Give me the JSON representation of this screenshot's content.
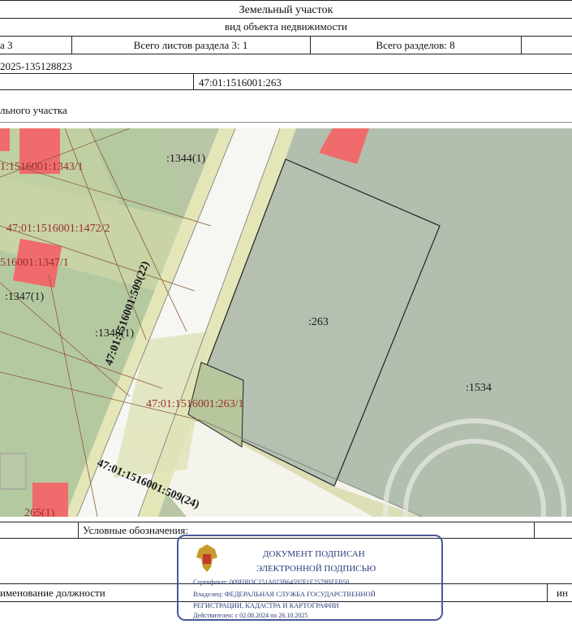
{
  "header": {
    "title": "Земельный участок",
    "subtitle": "вид объекта недвижимости"
  },
  "info_row": {
    "section": "а 3",
    "sheets": "Всего листов раздела 3: 1",
    "sections_total": "Всего разделов: 8"
  },
  "record_number": "2025-135128823",
  "cadastral_number": "47:01:1516001:263",
  "plan_title": "льного участка",
  "map": {
    "labels_red": [
      "1:1516001:1343/1",
      "47:01:1516001:1472/2",
      "516001:1347/1",
      "47:01:1516001:263/1",
      "265(1)"
    ],
    "labels_black": [
      ":1344(1)",
      ":1347(1)",
      ":1348(1)",
      ":263",
      ":1534"
    ],
    "road_labels": [
      "47:01:1516001:509(22)",
      "47:01:1516001:509(24)"
    ]
  },
  "legend": "Условные обозначения:",
  "footer": {
    "position_label": "именование должности",
    "right_label": "ин"
  },
  "signature": {
    "line1": "ДОКУМЕНТ ПОДПИСАН",
    "line2": "ЭЛЕКТРОННОЙ ПОДПИСЬЮ",
    "cert": "Сертификат: 009F0B3C151A023B64597F1E2579BEFB50",
    "owner1": "Владелец: ФЕДЕРАЛЬНАЯ СЛУЖБА ГОСУДАРСТВЕННОЙ",
    "owner2": "РЕГИСТРАЦИИ, КАДАСТРА И КАРТОГРАФИИ",
    "valid": "Действителен: с 02.08.2024 по 26.10.2025"
  },
  "colors": {
    "map_green": "#b7c7a2",
    "parcel_grey": "#b3bfb0",
    "yellow_zone": "#e1e3b8",
    "red_building": "#f06b6b",
    "stamp_blue": "#2a3a7a"
  }
}
